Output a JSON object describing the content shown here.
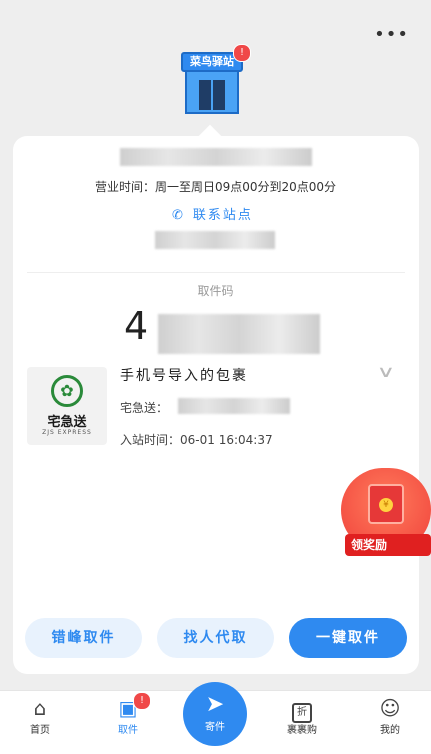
{
  "header": {
    "more_icon": "more-dots-icon",
    "more_label": "•••"
  },
  "station": {
    "sign_text": "菜鸟驿站",
    "badge": "!"
  },
  "info": {
    "hours": "营业时间：周一至周日09点00分到20点00分",
    "contact_label": "联系站点",
    "contact_icon": "phone-icon"
  },
  "pickup": {
    "code_label": "取件码",
    "code_first_char": "4"
  },
  "package": {
    "title": "手机号导入的包裹",
    "courier_label": "宅急送：",
    "time_label": "入站时间：",
    "time_value": "06-01 16:04:37",
    "logo_text": "宅急送",
    "logo_sub": "ZJS EXPRESS"
  },
  "promo": {
    "label": "领奖励"
  },
  "actions": {
    "stagger": "错峰取件",
    "proxy": "找人代取",
    "oneclick": "一键取件"
  },
  "tabs": [
    {
      "label": "首页",
      "icon": "home-icon"
    },
    {
      "label": "取件",
      "icon": "pickup-icon",
      "badge": "!"
    },
    {
      "label": "寄件",
      "icon": "send-icon"
    },
    {
      "label": "裹裹购",
      "icon": "shop-icon",
      "glyph": "折"
    },
    {
      "label": "我的",
      "icon": "profile-icon"
    }
  ],
  "colors": {
    "accent": "#2f8af0",
    "badge": "#f04848",
    "promo": "#f0413a"
  }
}
